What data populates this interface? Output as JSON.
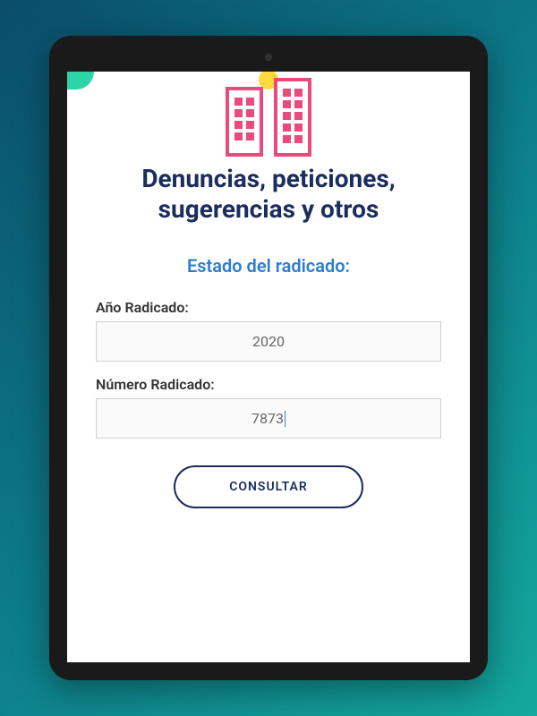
{
  "header": {
    "title": "Denuncias, peticiones, sugerencias y otros"
  },
  "section": {
    "subtitle": "Estado del radicado:"
  },
  "form": {
    "yearLabel": "Año Radicado:",
    "yearValue": "2020",
    "numberLabel": "Número Radicado:",
    "numberValue": "7873",
    "submitLabel": "CONSULTAR"
  }
}
